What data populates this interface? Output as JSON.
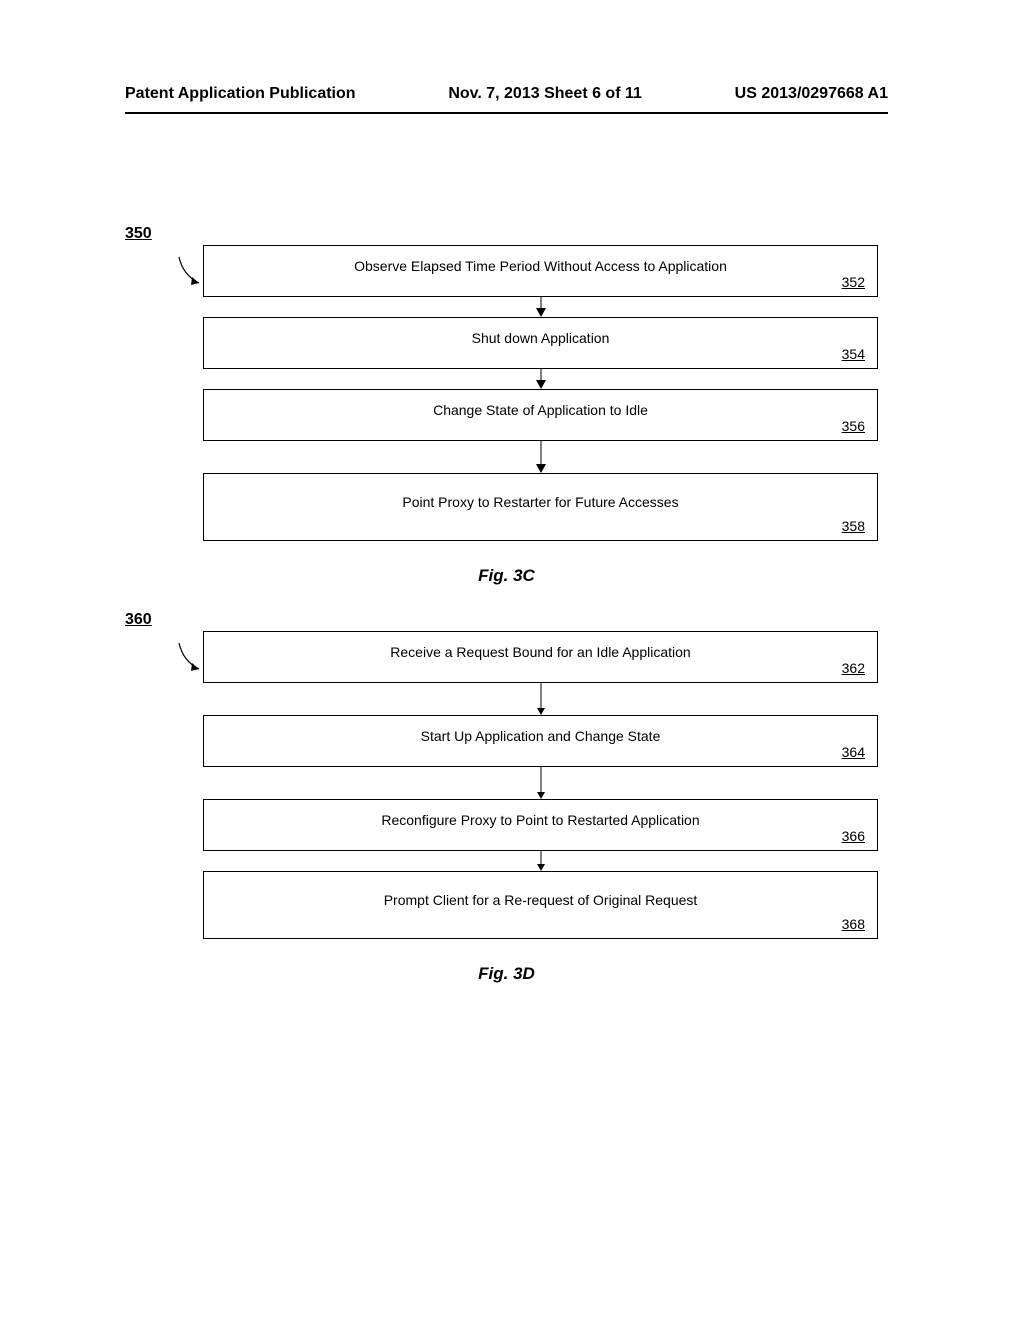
{
  "header": {
    "left": "Patent Application Publication",
    "center": "Nov. 7, 2013  Sheet 6 of 11",
    "right": "US 2013/0297668 A1"
  },
  "flowchart_3c": {
    "label": "350",
    "caption": "Fig. 3C",
    "boxes": [
      {
        "text": "Observe Elapsed Time Period Without Access to Application",
        "num": "352"
      },
      {
        "text": "Shut down Application",
        "num": "354"
      },
      {
        "text": "Change State of Application to Idle",
        "num": "356"
      },
      {
        "text": "Point Proxy to Restarter for Future Accesses",
        "num": "358"
      }
    ]
  },
  "flowchart_3d": {
    "label": "360",
    "caption": "Fig. 3D",
    "boxes": [
      {
        "text": "Receive a Request Bound for an Idle Application",
        "num": "362"
      },
      {
        "text": "Start Up Application and Change State",
        "num": "364"
      },
      {
        "text": "Reconfigure Proxy to Point to Restarted Application",
        "num": "366"
      },
      {
        "text": "Prompt Client for a Re-request of Original Request",
        "num": "368"
      }
    ]
  }
}
